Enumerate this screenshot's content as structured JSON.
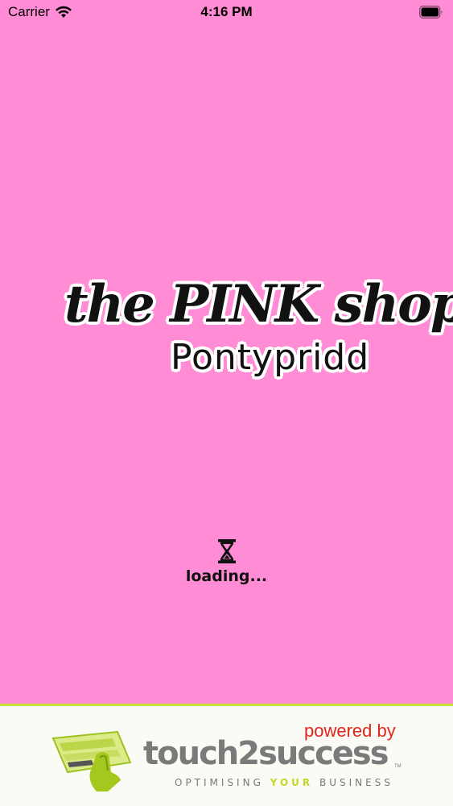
{
  "status_bar": {
    "carrier": "Carrier",
    "time": "4:16 PM"
  },
  "logo": {
    "line1": "the PINK shop",
    "line2": "Pontypridd"
  },
  "loading": {
    "text": "loading..."
  },
  "footer": {
    "powered_by": "powered by",
    "brand": "touch2success",
    "tm": "TM",
    "tagline_before": "OPTIMISING ",
    "tagline_highlight": "YOUR",
    "tagline_after": " BUSINESS"
  },
  "colors": {
    "background": "#ff8cd4",
    "footer_background": "#fbfbf6",
    "footer_border": "#c8e13a",
    "powered_by": "#e0251c",
    "brand_gray": "#7a7a7a",
    "tagline_highlight": "#c3d82a"
  },
  "icons": {
    "status_wifi": "wifi-icon",
    "status_battery": "battery-icon",
    "loader": "hourglass-icon",
    "brand_mark": "touch2success-logo-icon"
  }
}
